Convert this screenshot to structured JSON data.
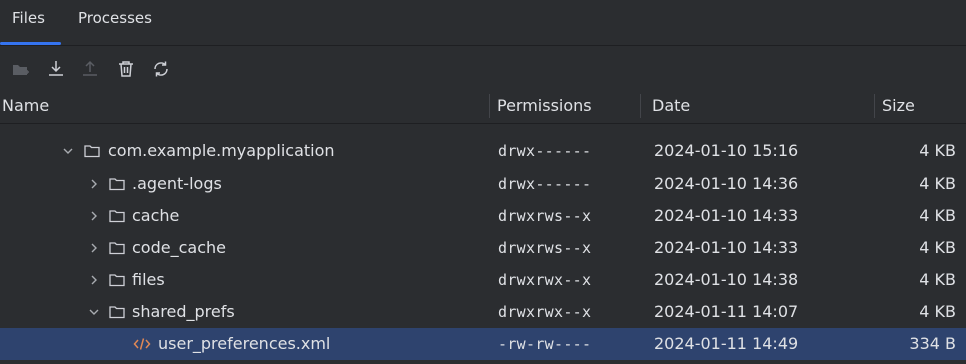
{
  "tabs": [
    {
      "label": "Files",
      "active": true
    },
    {
      "label": "Processes",
      "active": false
    }
  ],
  "toolbar": {
    "icons": [
      "new-folder-icon",
      "download-icon",
      "upload-icon",
      "delete-icon",
      "sync-icon"
    ]
  },
  "columns": {
    "name": "Name",
    "permissions": "Permissions",
    "date": "Date",
    "size": "Size"
  },
  "rows": [
    {
      "name": "com.example.myapplication",
      "expanded": true,
      "type": "folder",
      "permissions": "drwx------",
      "date": "2024-01-10 15:16",
      "size": "4 KB"
    },
    {
      "name": ".agent-logs",
      "expanded": false,
      "type": "folder",
      "permissions": "drwx------",
      "date": "2024-01-10 14:36",
      "size": "4 KB"
    },
    {
      "name": "cache",
      "expanded": false,
      "type": "folder",
      "permissions": "drwxrws--x",
      "date": "2024-01-10 14:33",
      "size": "4 KB"
    },
    {
      "name": "code_cache",
      "expanded": false,
      "type": "folder",
      "permissions": "drwxrws--x",
      "date": "2024-01-10 14:33",
      "size": "4 KB"
    },
    {
      "name": "files",
      "expanded": false,
      "type": "folder",
      "permissions": "drwxrwx--x",
      "date": "2024-01-10 14:38",
      "size": "4 KB"
    },
    {
      "name": "shared_prefs",
      "expanded": true,
      "type": "folder",
      "permissions": "drwxrwx--x",
      "date": "2024-01-11 14:07",
      "size": "4 KB"
    },
    {
      "name": "user_preferences.xml",
      "expanded": false,
      "type": "xml",
      "permissions": "-rw-rw----",
      "date": "2024-01-11 14:49",
      "size": "334 B",
      "selected": true
    }
  ],
  "colors": {
    "background": "#2b2d30",
    "accent": "#3574f0",
    "selection": "#2e436e",
    "xml_icon": "#e08855"
  }
}
